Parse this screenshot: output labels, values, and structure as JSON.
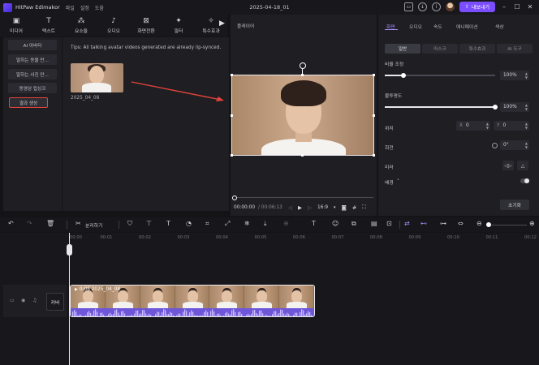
{
  "titlebar": {
    "app_name": "HitPaw Edimakor",
    "menu": [
      "파일",
      "설정",
      "도움"
    ],
    "document_title": "2025-04-18_01",
    "export_label": "내보내기"
  },
  "toolbar": {
    "tools": [
      {
        "icon": "media-icon",
        "label": "미디어"
      },
      {
        "icon": "text-icon",
        "label": "텍스트"
      },
      {
        "icon": "elements-icon",
        "label": "요소들"
      },
      {
        "icon": "audio-icon",
        "label": "오디오"
      },
      {
        "icon": "transition-icon",
        "label": "화면전환"
      },
      {
        "icon": "filter-icon",
        "label": "필터"
      },
      {
        "icon": "effects-icon",
        "label": "특수효과"
      }
    ]
  },
  "sidebar": {
    "items": [
      "AI 아바타",
      "말하는 동물 만...",
      "말하는 사진 만...",
      "동영상 립싱크",
      "결과 생성"
    ],
    "active_index": 4
  },
  "media": {
    "tips": "Tips:  All talking avatar videos generated are already lip-synced.",
    "thumb_label": "2025_04_08"
  },
  "player": {
    "title": "플레이어",
    "time_current": "00:00:00",
    "time_total": "/ 00:06:13",
    "ratio": "16:9"
  },
  "properties": {
    "tabs": [
      "화면",
      "오디오",
      "속도",
      "애니메이션",
      "색상"
    ],
    "active_tab": 0,
    "subtabs": [
      "일반",
      "마스크",
      "특수효과",
      "AI 도구"
    ],
    "active_subtab": 0,
    "scale_label": "비율 조정",
    "scale_value": "100%",
    "scale_fraction": 0.17,
    "opacity_label": "불투명도",
    "opacity_value": "100%",
    "opacity_fraction": 1.0,
    "position_label": "위치",
    "x_label": "X",
    "x_value": "0",
    "y_label": "Y",
    "y_value": "0",
    "rotate_label": "회전",
    "rotate_value": "0°",
    "mirror_label": "미러",
    "background_label": "배경",
    "reset_label": "초기화"
  },
  "timeline": {
    "split_label": "분리하기",
    "ruler": [
      "00:00",
      "00:01",
      "00:02",
      "00:03",
      "00:04",
      "00:05",
      "00:06",
      "00:07",
      "00:08",
      "00:09",
      "00:10",
      "00:11",
      "00:12"
    ],
    "track_cover": "커버",
    "clip_label": "0:06 2025_04_08"
  }
}
